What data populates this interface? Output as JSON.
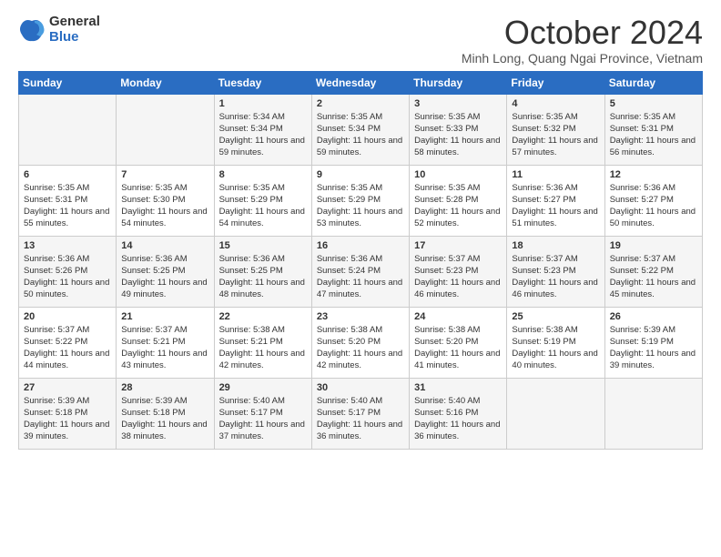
{
  "header": {
    "logo_general": "General",
    "logo_blue": "Blue",
    "month_title": "October 2024",
    "location": "Minh Long, Quang Ngai Province, Vietnam"
  },
  "days_of_week": [
    "Sunday",
    "Monday",
    "Tuesday",
    "Wednesday",
    "Thursday",
    "Friday",
    "Saturday"
  ],
  "weeks": [
    [
      {
        "day": "",
        "info": ""
      },
      {
        "day": "",
        "info": ""
      },
      {
        "day": "1",
        "info": "Sunrise: 5:34 AM\nSunset: 5:34 PM\nDaylight: 11 hours and 59 minutes."
      },
      {
        "day": "2",
        "info": "Sunrise: 5:35 AM\nSunset: 5:34 PM\nDaylight: 11 hours and 59 minutes."
      },
      {
        "day": "3",
        "info": "Sunrise: 5:35 AM\nSunset: 5:33 PM\nDaylight: 11 hours and 58 minutes."
      },
      {
        "day": "4",
        "info": "Sunrise: 5:35 AM\nSunset: 5:32 PM\nDaylight: 11 hours and 57 minutes."
      },
      {
        "day": "5",
        "info": "Sunrise: 5:35 AM\nSunset: 5:31 PM\nDaylight: 11 hours and 56 minutes."
      }
    ],
    [
      {
        "day": "6",
        "info": "Sunrise: 5:35 AM\nSunset: 5:31 PM\nDaylight: 11 hours and 55 minutes."
      },
      {
        "day": "7",
        "info": "Sunrise: 5:35 AM\nSunset: 5:30 PM\nDaylight: 11 hours and 54 minutes."
      },
      {
        "day": "8",
        "info": "Sunrise: 5:35 AM\nSunset: 5:29 PM\nDaylight: 11 hours and 54 minutes."
      },
      {
        "day": "9",
        "info": "Sunrise: 5:35 AM\nSunset: 5:29 PM\nDaylight: 11 hours and 53 minutes."
      },
      {
        "day": "10",
        "info": "Sunrise: 5:35 AM\nSunset: 5:28 PM\nDaylight: 11 hours and 52 minutes."
      },
      {
        "day": "11",
        "info": "Sunrise: 5:36 AM\nSunset: 5:27 PM\nDaylight: 11 hours and 51 minutes."
      },
      {
        "day": "12",
        "info": "Sunrise: 5:36 AM\nSunset: 5:27 PM\nDaylight: 11 hours and 50 minutes."
      }
    ],
    [
      {
        "day": "13",
        "info": "Sunrise: 5:36 AM\nSunset: 5:26 PM\nDaylight: 11 hours and 50 minutes."
      },
      {
        "day": "14",
        "info": "Sunrise: 5:36 AM\nSunset: 5:25 PM\nDaylight: 11 hours and 49 minutes."
      },
      {
        "day": "15",
        "info": "Sunrise: 5:36 AM\nSunset: 5:25 PM\nDaylight: 11 hours and 48 minutes."
      },
      {
        "day": "16",
        "info": "Sunrise: 5:36 AM\nSunset: 5:24 PM\nDaylight: 11 hours and 47 minutes."
      },
      {
        "day": "17",
        "info": "Sunrise: 5:37 AM\nSunset: 5:23 PM\nDaylight: 11 hours and 46 minutes."
      },
      {
        "day": "18",
        "info": "Sunrise: 5:37 AM\nSunset: 5:23 PM\nDaylight: 11 hours and 46 minutes."
      },
      {
        "day": "19",
        "info": "Sunrise: 5:37 AM\nSunset: 5:22 PM\nDaylight: 11 hours and 45 minutes."
      }
    ],
    [
      {
        "day": "20",
        "info": "Sunrise: 5:37 AM\nSunset: 5:22 PM\nDaylight: 11 hours and 44 minutes."
      },
      {
        "day": "21",
        "info": "Sunrise: 5:37 AM\nSunset: 5:21 PM\nDaylight: 11 hours and 43 minutes."
      },
      {
        "day": "22",
        "info": "Sunrise: 5:38 AM\nSunset: 5:21 PM\nDaylight: 11 hours and 42 minutes."
      },
      {
        "day": "23",
        "info": "Sunrise: 5:38 AM\nSunset: 5:20 PM\nDaylight: 11 hours and 42 minutes."
      },
      {
        "day": "24",
        "info": "Sunrise: 5:38 AM\nSunset: 5:20 PM\nDaylight: 11 hours and 41 minutes."
      },
      {
        "day": "25",
        "info": "Sunrise: 5:38 AM\nSunset: 5:19 PM\nDaylight: 11 hours and 40 minutes."
      },
      {
        "day": "26",
        "info": "Sunrise: 5:39 AM\nSunset: 5:19 PM\nDaylight: 11 hours and 39 minutes."
      }
    ],
    [
      {
        "day": "27",
        "info": "Sunrise: 5:39 AM\nSunset: 5:18 PM\nDaylight: 11 hours and 39 minutes."
      },
      {
        "day": "28",
        "info": "Sunrise: 5:39 AM\nSunset: 5:18 PM\nDaylight: 11 hours and 38 minutes."
      },
      {
        "day": "29",
        "info": "Sunrise: 5:40 AM\nSunset: 5:17 PM\nDaylight: 11 hours and 37 minutes."
      },
      {
        "day": "30",
        "info": "Sunrise: 5:40 AM\nSunset: 5:17 PM\nDaylight: 11 hours and 36 minutes."
      },
      {
        "day": "31",
        "info": "Sunrise: 5:40 AM\nSunset: 5:16 PM\nDaylight: 11 hours and 36 minutes."
      },
      {
        "day": "",
        "info": ""
      },
      {
        "day": "",
        "info": ""
      }
    ]
  ]
}
